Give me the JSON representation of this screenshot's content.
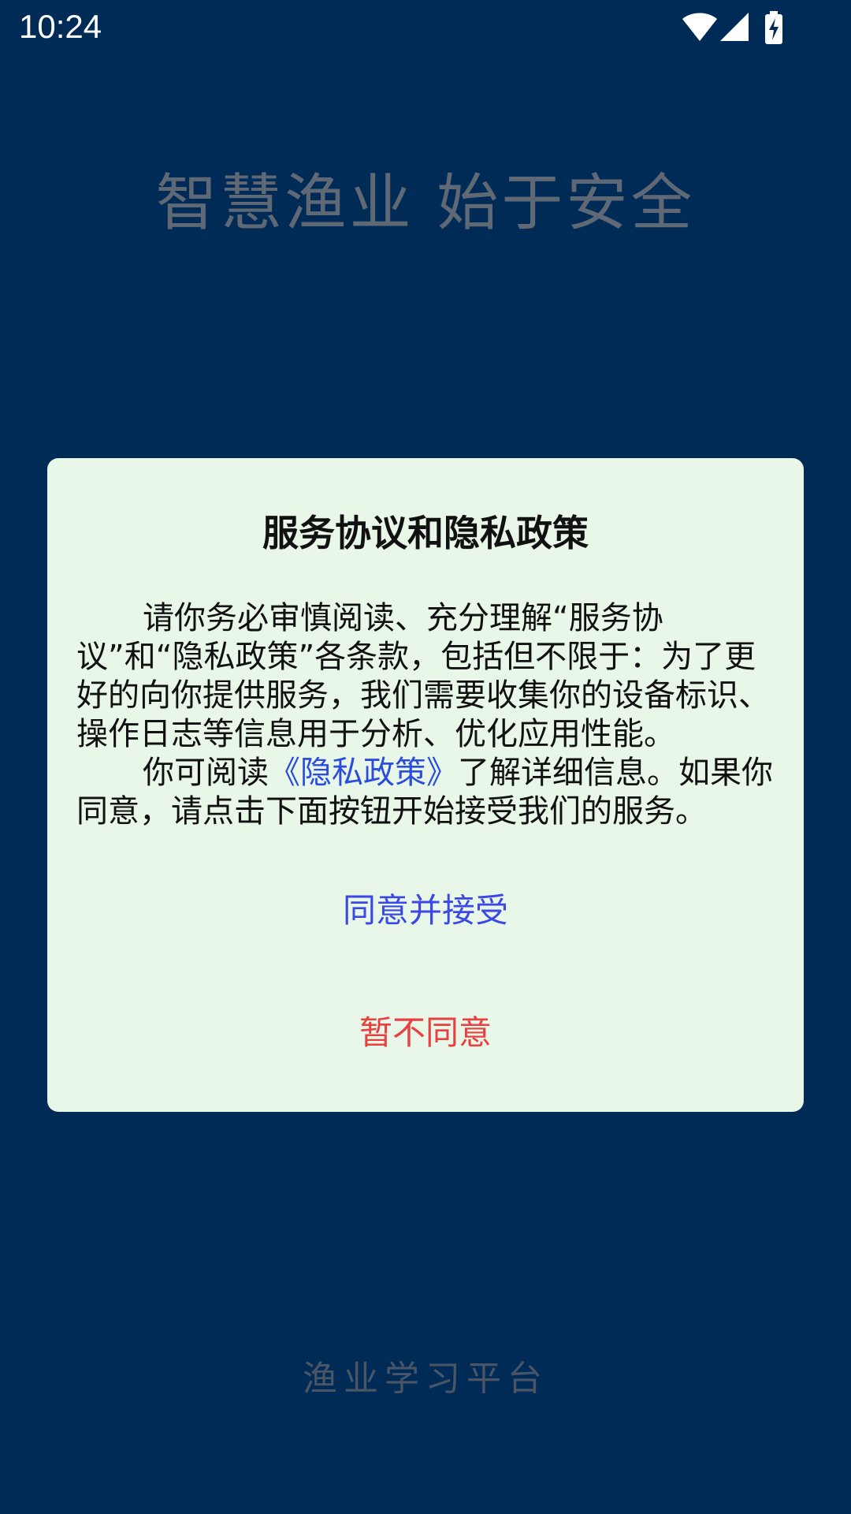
{
  "status_bar": {
    "time": "10:24",
    "icons": [
      "wifi-icon",
      "cellular-signal-icon",
      "battery-charging-icon"
    ]
  },
  "splash": {
    "slogan": "智慧渔业  始于安全",
    "footer": "渔业学习平台"
  },
  "dialog": {
    "title": "服务协议和隐私政策",
    "paragraph1": "请你务必审慎阅读、充分理解“服务协议”和“隐私政策”各条款，包括但不限于：为了更好的向你提供服务，我们需要收集你的设备标识、操作日志等信息用于分析、优化应用性能。",
    "paragraph2_prefix": "你可阅读",
    "privacy_link": "《隐私政策》",
    "paragraph2_suffix": "了解详细信息。如果你同意，请点击下面按钮开始接受我们的服务。",
    "agree_label": "同意并接受",
    "disagree_label": "暂不同意"
  },
  "colors": {
    "background": "#012b57",
    "dialog_background": "#e9f7e8",
    "link": "#2a4de0",
    "agree": "#3b48e6",
    "disagree": "#e84040"
  }
}
